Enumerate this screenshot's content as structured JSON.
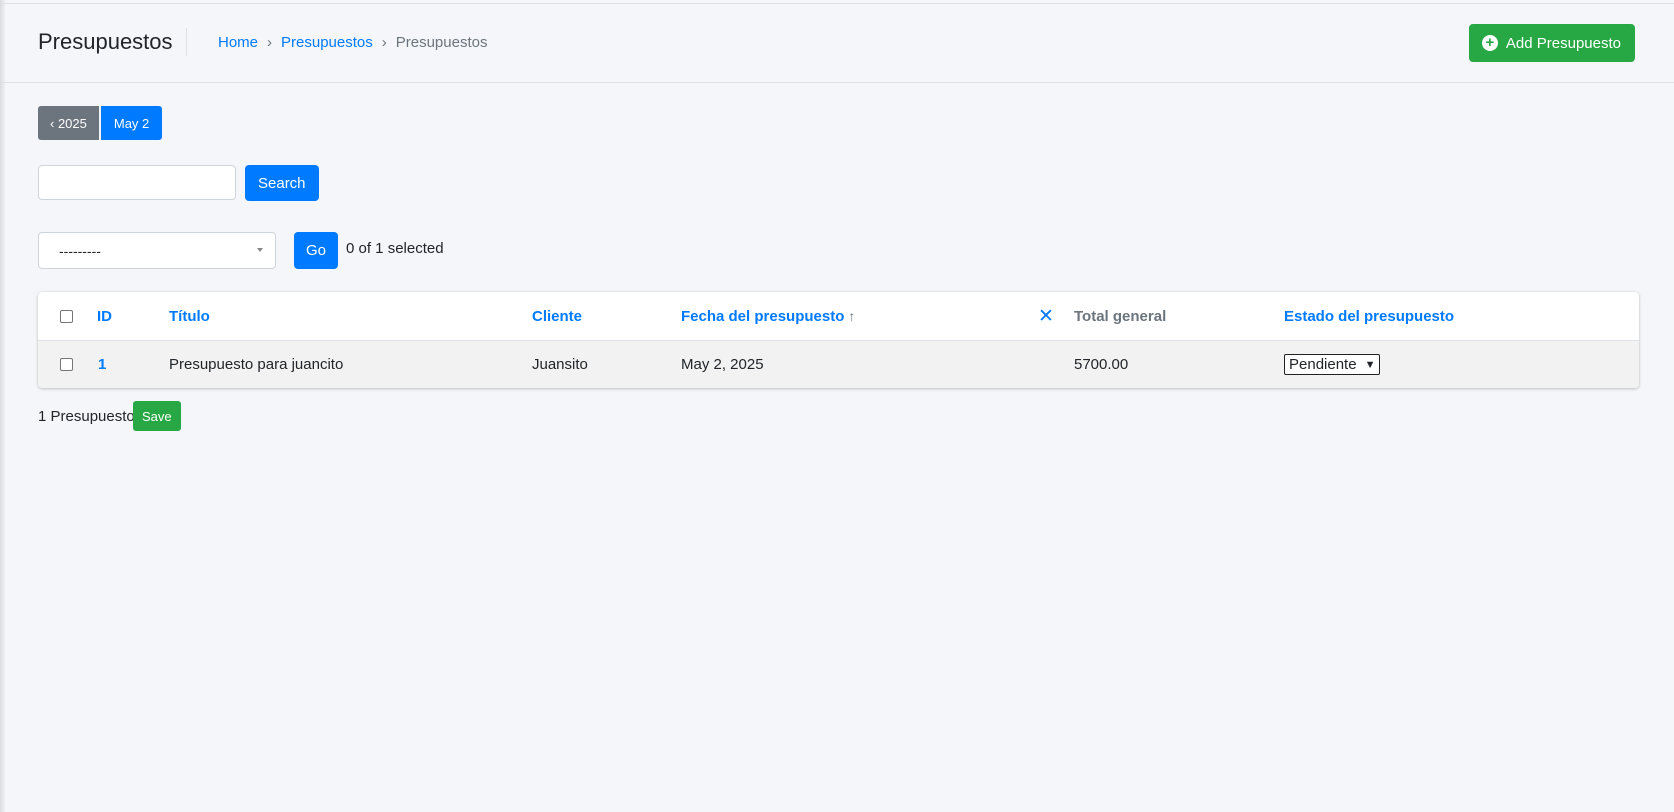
{
  "header": {
    "title": "Presupuestos",
    "breadcrumb": [
      {
        "label": "Home"
      },
      {
        "label": "Presupuestos"
      },
      {
        "label": "Presupuestos"
      }
    ],
    "breadcrumb_separator": "›",
    "add_button_label": "Add Presupuesto"
  },
  "date_hierarchy": {
    "year_label": "‹ 2025",
    "day_label": "May 2"
  },
  "search": {
    "value": "",
    "button_label": "Search"
  },
  "actions": {
    "selected_option": "---------",
    "go_label": "Go",
    "selection_counter": "0 of 1 selected"
  },
  "table": {
    "columns": {
      "id": "ID",
      "titulo": "Título",
      "cliente": "Cliente",
      "fecha": "Fecha del presupuesto",
      "fecha_sort_icon": "↑",
      "clear_sort": "✕",
      "total": "Total general",
      "estado": "Estado del presupuesto"
    },
    "rows": [
      {
        "id": "1",
        "titulo": "Presupuesto para juancito",
        "cliente": "Juansito",
        "fecha": "May 2, 2025",
        "total": "5700.00",
        "estado": "Pendiente"
      }
    ]
  },
  "footer": {
    "result_count": "1 Presupuesto",
    "save_label": "Save"
  },
  "colors": {
    "primary": "#007bff",
    "success": "#28a745",
    "secondary": "#6c757d",
    "background": "#f4f6f9"
  }
}
